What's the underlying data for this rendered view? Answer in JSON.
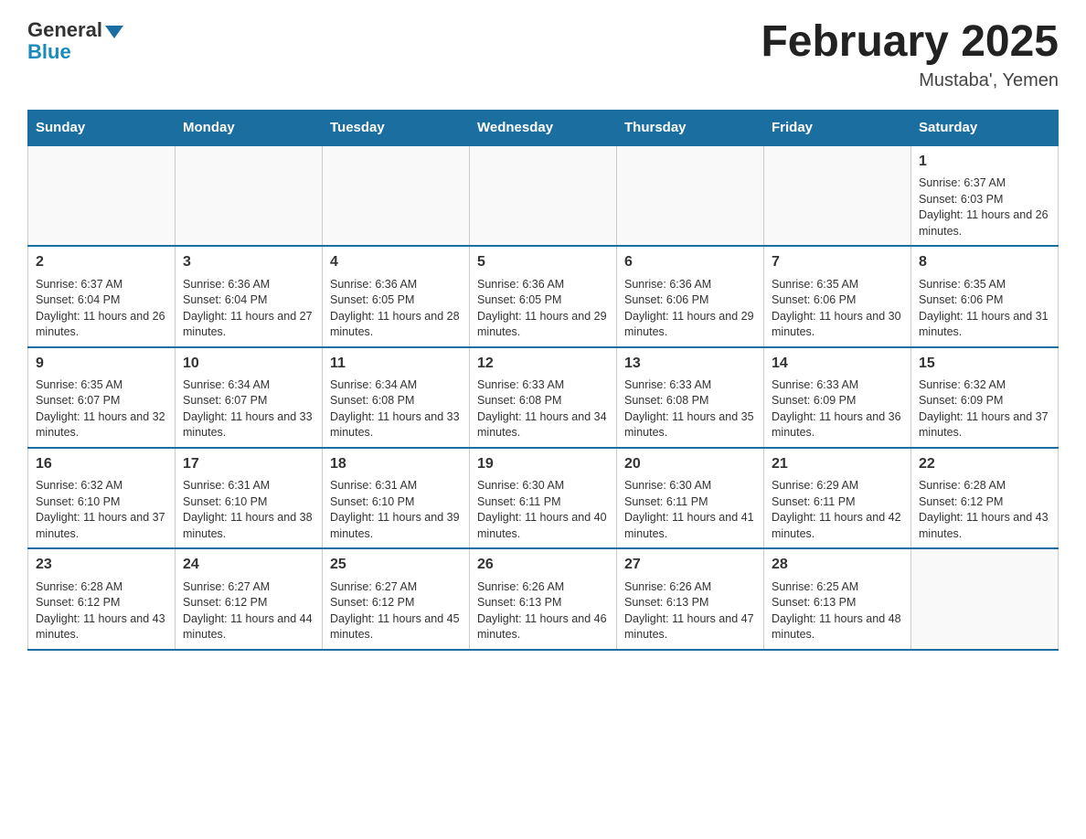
{
  "header": {
    "logo_general": "General",
    "logo_blue": "Blue",
    "month_title": "February 2025",
    "location": "Mustaba', Yemen"
  },
  "days_of_week": [
    "Sunday",
    "Monday",
    "Tuesday",
    "Wednesday",
    "Thursday",
    "Friday",
    "Saturday"
  ],
  "weeks": [
    [
      {
        "day": null
      },
      {
        "day": null
      },
      {
        "day": null
      },
      {
        "day": null
      },
      {
        "day": null
      },
      {
        "day": null
      },
      {
        "day": 1,
        "sunrise": "6:37 AM",
        "sunset": "6:03 PM",
        "daylight": "11 hours and 26 minutes."
      }
    ],
    [
      {
        "day": 2,
        "sunrise": "6:37 AM",
        "sunset": "6:04 PM",
        "daylight": "11 hours and 26 minutes."
      },
      {
        "day": 3,
        "sunrise": "6:36 AM",
        "sunset": "6:04 PM",
        "daylight": "11 hours and 27 minutes."
      },
      {
        "day": 4,
        "sunrise": "6:36 AM",
        "sunset": "6:05 PM",
        "daylight": "11 hours and 28 minutes."
      },
      {
        "day": 5,
        "sunrise": "6:36 AM",
        "sunset": "6:05 PM",
        "daylight": "11 hours and 29 minutes."
      },
      {
        "day": 6,
        "sunrise": "6:36 AM",
        "sunset": "6:06 PM",
        "daylight": "11 hours and 29 minutes."
      },
      {
        "day": 7,
        "sunrise": "6:35 AM",
        "sunset": "6:06 PM",
        "daylight": "11 hours and 30 minutes."
      },
      {
        "day": 8,
        "sunrise": "6:35 AM",
        "sunset": "6:06 PM",
        "daylight": "11 hours and 31 minutes."
      }
    ],
    [
      {
        "day": 9,
        "sunrise": "6:35 AM",
        "sunset": "6:07 PM",
        "daylight": "11 hours and 32 minutes."
      },
      {
        "day": 10,
        "sunrise": "6:34 AM",
        "sunset": "6:07 PM",
        "daylight": "11 hours and 33 minutes."
      },
      {
        "day": 11,
        "sunrise": "6:34 AM",
        "sunset": "6:08 PM",
        "daylight": "11 hours and 33 minutes."
      },
      {
        "day": 12,
        "sunrise": "6:33 AM",
        "sunset": "6:08 PM",
        "daylight": "11 hours and 34 minutes."
      },
      {
        "day": 13,
        "sunrise": "6:33 AM",
        "sunset": "6:08 PM",
        "daylight": "11 hours and 35 minutes."
      },
      {
        "day": 14,
        "sunrise": "6:33 AM",
        "sunset": "6:09 PM",
        "daylight": "11 hours and 36 minutes."
      },
      {
        "day": 15,
        "sunrise": "6:32 AM",
        "sunset": "6:09 PM",
        "daylight": "11 hours and 37 minutes."
      }
    ],
    [
      {
        "day": 16,
        "sunrise": "6:32 AM",
        "sunset": "6:10 PM",
        "daylight": "11 hours and 37 minutes."
      },
      {
        "day": 17,
        "sunrise": "6:31 AM",
        "sunset": "6:10 PM",
        "daylight": "11 hours and 38 minutes."
      },
      {
        "day": 18,
        "sunrise": "6:31 AM",
        "sunset": "6:10 PM",
        "daylight": "11 hours and 39 minutes."
      },
      {
        "day": 19,
        "sunrise": "6:30 AM",
        "sunset": "6:11 PM",
        "daylight": "11 hours and 40 minutes."
      },
      {
        "day": 20,
        "sunrise": "6:30 AM",
        "sunset": "6:11 PM",
        "daylight": "11 hours and 41 minutes."
      },
      {
        "day": 21,
        "sunrise": "6:29 AM",
        "sunset": "6:11 PM",
        "daylight": "11 hours and 42 minutes."
      },
      {
        "day": 22,
        "sunrise": "6:28 AM",
        "sunset": "6:12 PM",
        "daylight": "11 hours and 43 minutes."
      }
    ],
    [
      {
        "day": 23,
        "sunrise": "6:28 AM",
        "sunset": "6:12 PM",
        "daylight": "11 hours and 43 minutes."
      },
      {
        "day": 24,
        "sunrise": "6:27 AM",
        "sunset": "6:12 PM",
        "daylight": "11 hours and 44 minutes."
      },
      {
        "day": 25,
        "sunrise": "6:27 AM",
        "sunset": "6:12 PM",
        "daylight": "11 hours and 45 minutes."
      },
      {
        "day": 26,
        "sunrise": "6:26 AM",
        "sunset": "6:13 PM",
        "daylight": "11 hours and 46 minutes."
      },
      {
        "day": 27,
        "sunrise": "6:26 AM",
        "sunset": "6:13 PM",
        "daylight": "11 hours and 47 minutes."
      },
      {
        "day": 28,
        "sunrise": "6:25 AM",
        "sunset": "6:13 PM",
        "daylight": "11 hours and 48 minutes."
      },
      {
        "day": null
      }
    ]
  ]
}
